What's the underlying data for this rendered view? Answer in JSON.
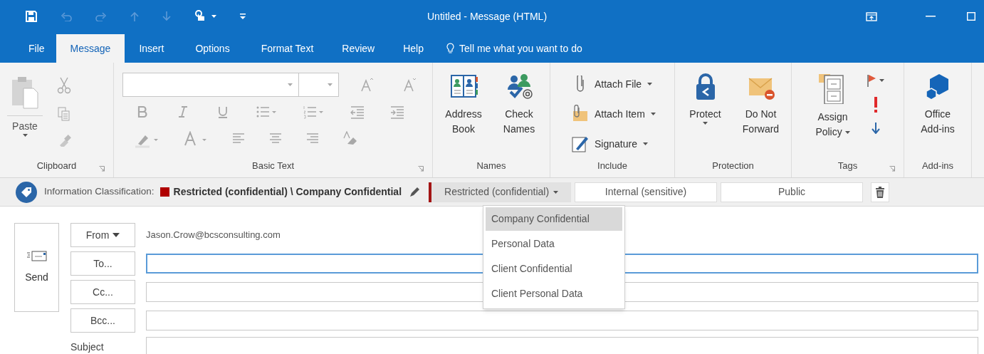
{
  "window": {
    "title": "Untitled - Message (HTML)"
  },
  "tabs": [
    {
      "label": "File",
      "selected": false
    },
    {
      "label": "Message",
      "selected": true
    },
    {
      "label": "Insert",
      "selected": false
    },
    {
      "label": "Options",
      "selected": false
    },
    {
      "label": "Format Text",
      "selected": false
    },
    {
      "label": "Review",
      "selected": false
    },
    {
      "label": "Help",
      "selected": false
    }
  ],
  "tell_me": {
    "placeholder": "Tell me what you want to do"
  },
  "ribbon": {
    "groups": [
      {
        "kind": "clipboard",
        "label": "Clipboard",
        "launcher": true,
        "disabled": true,
        "paste": "Paste"
      },
      {
        "kind": "basic_text",
        "label": "Basic Text",
        "launcher": true,
        "disabled": true
      },
      {
        "kind": "large",
        "label": "Names",
        "launcher": false,
        "buttons": [
          {
            "label": "Address Book",
            "dropdown": false
          },
          {
            "label": "Check Names",
            "dropdown": false
          }
        ]
      },
      {
        "kind": "small",
        "label": "Include",
        "launcher": false,
        "buttons": [
          {
            "label": "Attach File",
            "dropdown": true
          },
          {
            "label": "Attach Item",
            "dropdown": true
          },
          {
            "label": "Signature",
            "dropdown": true
          }
        ]
      },
      {
        "kind": "large",
        "label": "Protection",
        "launcher": false,
        "buttons": [
          {
            "label": "Protect",
            "dropdown": true
          },
          {
            "label": "Do Not Forward",
            "dropdown": false
          }
        ]
      },
      {
        "kind": "tags",
        "label": "Tags",
        "launcher": true,
        "buttons": [
          {
            "label": "Assign Policy",
            "dropdown": true
          }
        ]
      },
      {
        "kind": "large",
        "label": "Add-ins",
        "launcher": false,
        "buttons": [
          {
            "label": "Office Add-ins",
            "dropdown": false
          }
        ]
      }
    ]
  },
  "classification": {
    "label": "Information Classification:",
    "current": "Restricted (confidential) \\ Company Confidential",
    "color": "#b00000",
    "levels": [
      {
        "label": "Restricted (confidential)",
        "selected": true,
        "dropdown": true
      },
      {
        "label": "Internal (sensitive)",
        "selected": false,
        "dropdown": false
      },
      {
        "label": "Public",
        "selected": false,
        "dropdown": false
      }
    ],
    "menu": [
      {
        "label": "Company Confidential",
        "selected": true
      },
      {
        "label": "Personal Data",
        "selected": false
      },
      {
        "label": "Client Confidential",
        "selected": false
      },
      {
        "label": "Client Personal Data",
        "selected": false
      }
    ]
  },
  "compose": {
    "send": "Send",
    "from": {
      "label": "From",
      "value": "Jason.Crow@bcsconsulting.com"
    },
    "recipients": [
      {
        "label": "To...",
        "focused": true
      },
      {
        "label": "Cc...",
        "focused": false
      },
      {
        "label": "Bcc...",
        "focused": false
      }
    ],
    "subject": {
      "label": "Subject"
    }
  }
}
